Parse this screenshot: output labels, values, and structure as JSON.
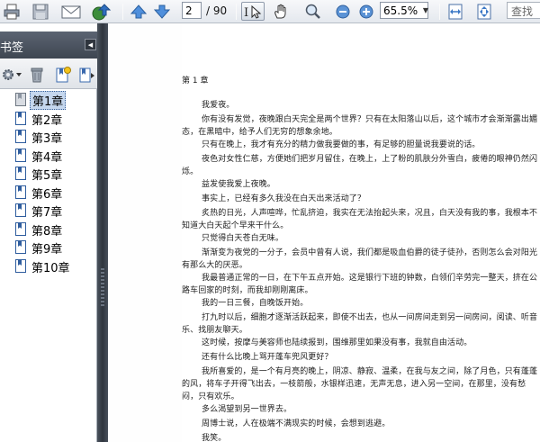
{
  "toolbar": {
    "page_current": "2",
    "page_total": "/ 90",
    "zoom": "65.5%",
    "search_placeholder": "查找",
    "icons": [
      "print-icon",
      "save-icon",
      "email-icon",
      "upload-icon",
      "page-up-icon",
      "page-down-icon",
      "text-select-icon",
      "hand-tool-icon",
      "zoom-marquee-icon",
      "zoom-out-icon",
      "zoom-in-icon",
      "fit-width-icon",
      "fit-page-icon"
    ]
  },
  "bookmarks": {
    "title": "书签",
    "tools": [
      "options-gear-icon",
      "delete-bookmark-icon",
      "new-bookmark-icon",
      "expand-bookmark-icon"
    ],
    "items": [
      {
        "label": "第1章",
        "selected": true
      },
      {
        "label": "第2章"
      },
      {
        "label": "第3章"
      },
      {
        "label": "第4章"
      },
      {
        "label": "第5章"
      },
      {
        "label": "第6章"
      },
      {
        "label": "第7章"
      },
      {
        "label": "第8章"
      },
      {
        "label": "第9章"
      },
      {
        "label": "第10章"
      }
    ]
  },
  "document": {
    "chapter_title": "第 1 章",
    "paragraphs": [
      "我爱夜。",
      "你有没有发觉，夜晚跟白天完全是两个世界？只有在太阳落山以后，这个城市才会渐渐露出媚态，在黑暗中，给予人们无穷的想象余地。",
      "只有在晚上，我才有充分的精力做我要做的事，有足够的胆量说我要说的话。",
      "夜色对女性仁慈，方便她们把岁月留住，在晚上，上了粉的肌肤分外雪白，疲倦的眼神仍然闪烁。",
      "益发使我爱上夜晚。",
      "事实上，已经有多久我没在白天出来活动了？",
      "炙热的日光，人声喧哗，忙乱挤迫，我实在无法抬起头来，况且，白天没有我的事，我根本不知道大白天起个早来干什么。",
      "只觉得白天苍白无味。",
      "渐渐变为夜党的一分子，会员中曾有人说，我们都是吸血伯爵的徒子徒孙，否则怎么会对阳光有那么大的厌恶。",
      "我最普通正常的一日，在下午五点开始。这是银行下班的钟数，白领们辛劳完一整天，挤在公路车回家的时刻，而我却刚刚离床。",
      "我的一日三餐，自晚饭开始。",
      "打九时以后，细胞才逐渐活跃起来，即使不出去，也从一间房间走到另一间房间，阅读、听音乐、找朋友聊天。",
      "这时候，按摩与美容师也陆续报到，围维那里如果没有事，我就自由活动。",
      "还有什么比晚上骂开蓬车兜风更好？",
      "我所喜爱的，是一个有月亮的晚上，阴凉、静寂、温柔，在我与友之间，除了月色，只有蓬蓬的风，将车子开得飞出去，一枝箭般，水银样迅速，无声无息，进入另一空间，在那里，没有愁闷，只有欢乐。",
      "多么渴望到另一世界去。",
      "周博士说，人在极端不满现实的时候，会想到逃避。",
      "我笑。"
    ]
  }
}
